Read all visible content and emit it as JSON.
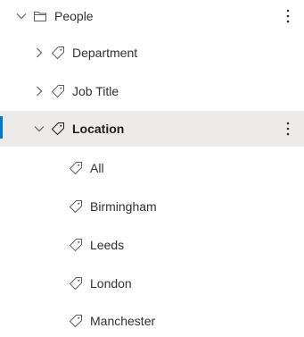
{
  "tree": {
    "root": {
      "label": "People",
      "icon": "folder-icon",
      "expanded": true
    },
    "groups": [
      {
        "label": "Department",
        "icon": "tag-icon",
        "expanded": false
      },
      {
        "label": "Job Title",
        "icon": "tag-icon",
        "expanded": false
      },
      {
        "label": "Location",
        "icon": "tag-icon",
        "expanded": true,
        "selected": true
      }
    ],
    "location_terms": [
      {
        "label": "All",
        "icon": "tag-icon"
      },
      {
        "label": "Birmingham",
        "icon": "tag-icon"
      },
      {
        "label": "Leeds",
        "icon": "tag-icon"
      },
      {
        "label": "London",
        "icon": "tag-icon"
      },
      {
        "label": "Manchester",
        "icon": "tag-icon"
      }
    ]
  },
  "colors": {
    "selected_background": "#edebe9",
    "selected_indicator": "#0078d4",
    "text": "#323130",
    "icon": "#605e5c"
  }
}
